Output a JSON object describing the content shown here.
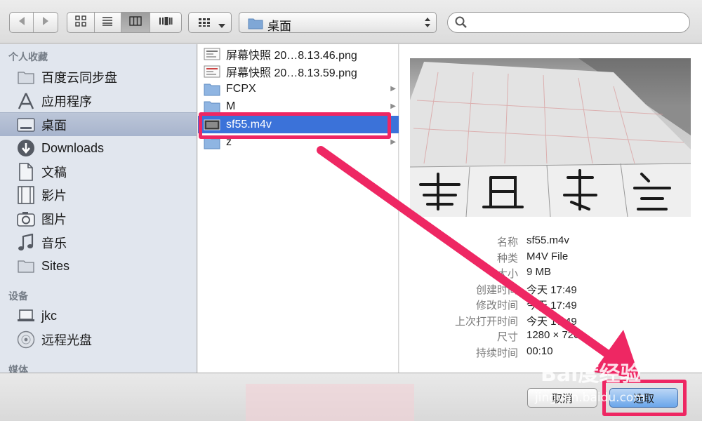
{
  "toolbar": {
    "nav_buttons": [
      "back-icon",
      "forward-icon"
    ],
    "view_buttons": [
      "icon-view-icon",
      "list-view-icon",
      "column-view-icon",
      "coverflow-view-icon"
    ],
    "active_view": "column",
    "arrange_icon": "arrange-grid-icon",
    "location": "桌面",
    "search_placeholder": ""
  },
  "sidebar": {
    "sections": [
      {
        "title": "个人收藏"
      },
      {
        "title": "设备"
      },
      {
        "title": "媒体"
      }
    ],
    "favorites": [
      {
        "label": "百度云同步盘",
        "icon": "folder-icon"
      },
      {
        "label": "应用程序",
        "icon": "applications-icon"
      },
      {
        "label": "桌面",
        "icon": "desktop-icon",
        "selected": true
      },
      {
        "label": "Downloads",
        "icon": "downloads-icon"
      },
      {
        "label": "文稿",
        "icon": "documents-icon"
      },
      {
        "label": "影片",
        "icon": "movies-icon"
      },
      {
        "label": "图片",
        "icon": "camera-icon"
      },
      {
        "label": "音乐",
        "icon": "music-note-icon"
      },
      {
        "label": "Sites",
        "icon": "folder-icon"
      }
    ],
    "devices": [
      {
        "label": "jkc",
        "icon": "laptop-icon"
      },
      {
        "label": "远程光盘",
        "icon": "disc-icon"
      }
    ]
  },
  "files": [
    {
      "name": "屏幕快照 20…8.13.46.png",
      "icon": "image-file-icon",
      "folder": false
    },
    {
      "name": "屏幕快照 20…8.13.59.png",
      "icon": "image-file-icon",
      "folder": false
    },
    {
      "name": "FCPX",
      "icon": "folder-icon",
      "folder": true
    },
    {
      "name": "M",
      "icon": "folder-icon",
      "folder": true
    },
    {
      "name": "sf55.m4v",
      "icon": "video-file-icon",
      "folder": false,
      "selected": true
    },
    {
      "name": "z",
      "icon": "folder-icon",
      "folder": true
    }
  ],
  "preview": {
    "rows": [
      {
        "key": "名称",
        "value": "sf55.m4v"
      },
      {
        "key": "种类",
        "value": "M4V File"
      },
      {
        "key": "大小",
        "value": "9 MB"
      },
      {
        "key": "创建时间",
        "value": "今天 17:49"
      },
      {
        "key": "修改时间",
        "value": "今天 17:49"
      },
      {
        "key": "上次打开时间",
        "value": "今天 17:49"
      },
      {
        "key": "尺寸",
        "value": "1280 × 720"
      },
      {
        "key": "持续时间",
        "value": "00:10"
      }
    ]
  },
  "buttons": {
    "cancel": "取消",
    "choose": "选取"
  },
  "watermark": {
    "brand": "Bai度经验",
    "url": "jingyan.baidu.com"
  },
  "colors": {
    "accent_annotation": "#ee2763",
    "selection": "#3b72d9",
    "sidebar_bg": "#e1e6ee"
  }
}
